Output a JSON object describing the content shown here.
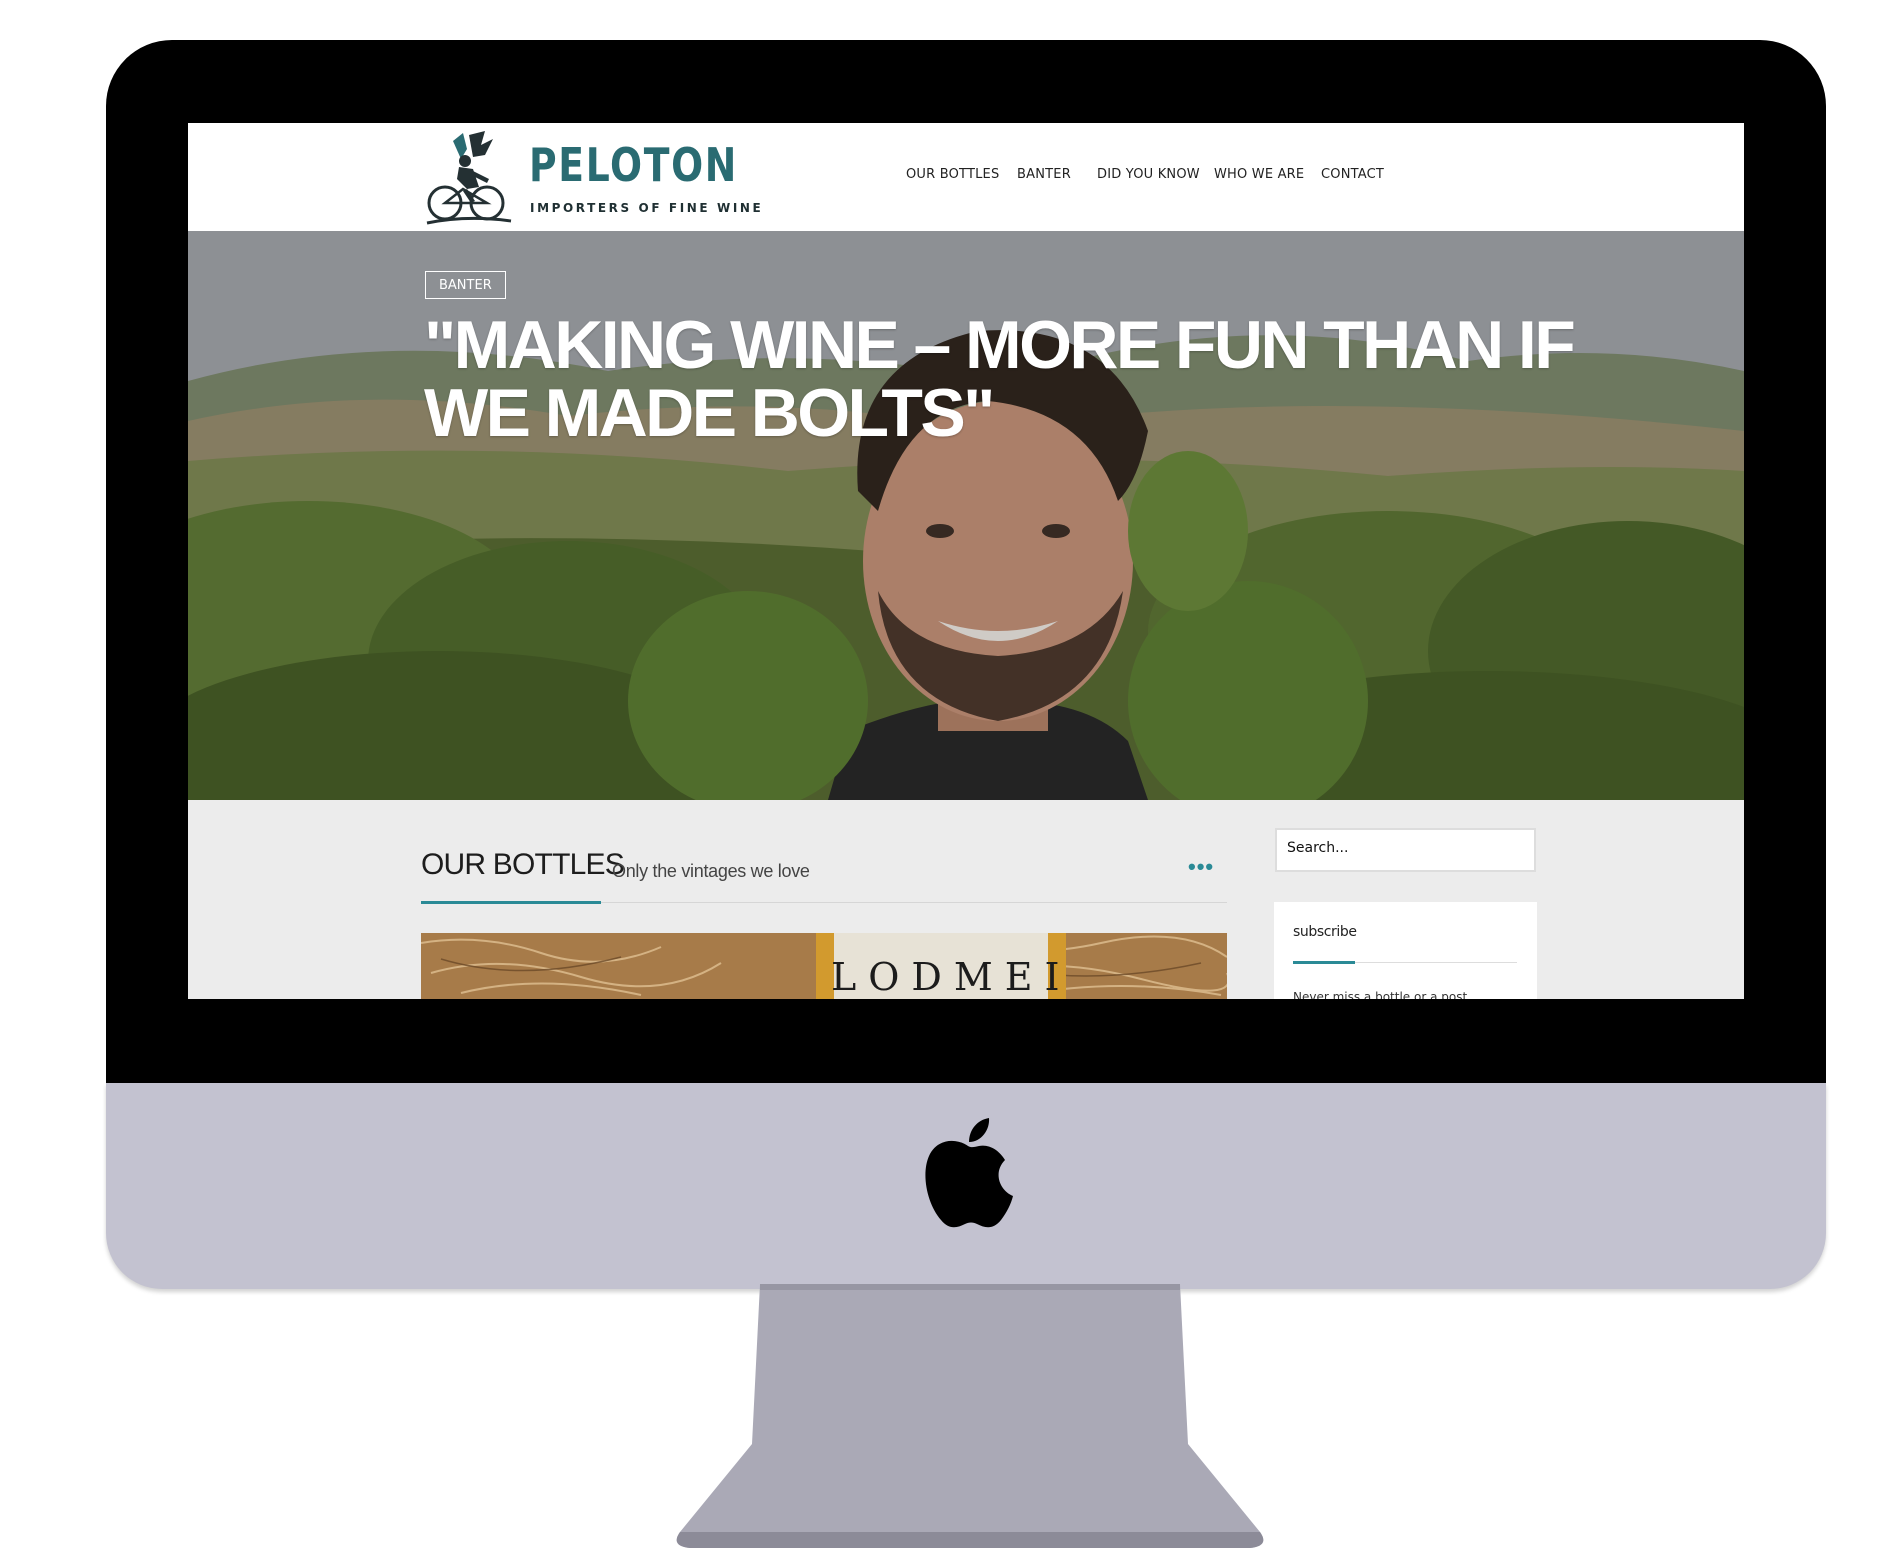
{
  "brand": {
    "name": "PELOTON",
    "tagline": "IMPORTERS OF FINE WINE",
    "accent_color": "#2a6b72",
    "highlight_color": "#2a8a96"
  },
  "nav": {
    "items": [
      "OUR BOTTLES",
      "BANTER",
      "DID YOU KNOW",
      "WHO WE ARE",
      "CONTACT"
    ]
  },
  "hero": {
    "category": "BANTER",
    "title": "\"MAKING WINE – MORE FUN THAN IF WE MADE BOLTS\""
  },
  "section": {
    "title": "OUR BOTTLES",
    "subtitle": "Only the vintages we love",
    "more_icon": "ellipsis-icon",
    "image_label": "LODMEI"
  },
  "sidebar": {
    "search_placeholder": "Search...",
    "widget_title": "subscribe",
    "widget_text": "Never miss a bottle or a post"
  },
  "device": {
    "logo_icon": "apple-logo-icon"
  }
}
